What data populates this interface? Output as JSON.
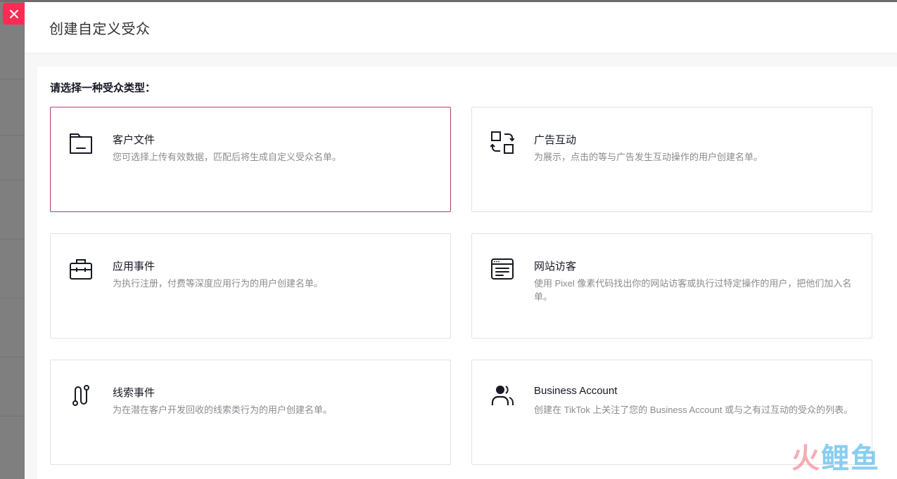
{
  "drawer": {
    "title": "创建自定义受众",
    "close_icon": "close-icon"
  },
  "prompt": "请选择一种受众类型：",
  "cards": [
    {
      "title": "客户文件",
      "description": "您可选择上传有效数据，匹配后将生成自定义受众名单。",
      "icon": "folder-icon",
      "selected": true
    },
    {
      "title": "广告互动",
      "description": "为展示，点击的等与广告发生互动操作的用户创建名单。",
      "icon": "interaction-icon",
      "selected": false
    },
    {
      "title": "应用事件",
      "description": "为执行注册，付费等深度应用行为的用户创建名单。",
      "icon": "briefcase-icon",
      "selected": false
    },
    {
      "title": "网站访客",
      "description": "使用 Pixel 像素代码找出你的网站访客或执行过特定操作的用户，把他们加入名单。",
      "icon": "browser-icon",
      "selected": false
    },
    {
      "title": "线索事件",
      "description": "为在潜在客户开发回收的线索类行为的用户创建名单。",
      "icon": "route-icon",
      "selected": false
    },
    {
      "title": "Business Account",
      "description": "创建在 TikTok 上关注了您的 Business Account 或与之有过互动的受众的列表。",
      "icon": "users-icon",
      "selected": false
    }
  ],
  "watermark": {
    "first": "火",
    "rest": "鲤鱼"
  },
  "colors": {
    "accent": "#fe2c55",
    "selected_border": "#b23a7e",
    "text_primary": "#161823",
    "text_secondary": "#8a8b91"
  }
}
